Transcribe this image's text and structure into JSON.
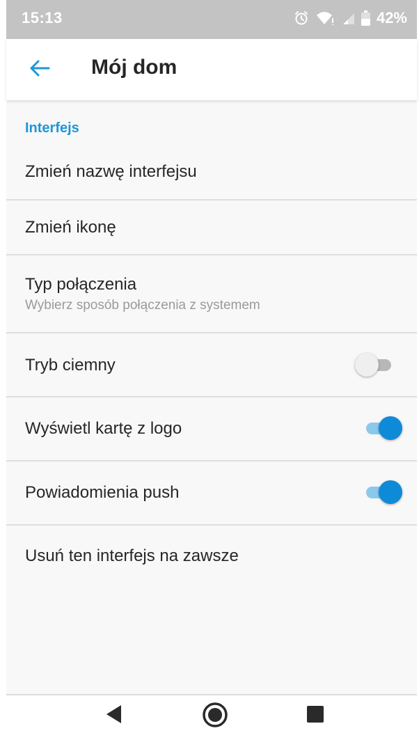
{
  "status_bar": {
    "time": "15:13",
    "battery_percent": "42%",
    "icons": [
      "alarm-icon",
      "wifi-icon",
      "signal-icon",
      "battery-icon"
    ]
  },
  "app_bar": {
    "back_icon": "arrow-left-icon",
    "title": "Mój dom"
  },
  "section": {
    "header": "Interfejs",
    "items": [
      {
        "title": "Zmień nazwę interfejsu"
      },
      {
        "title": "Zmień ikonę"
      },
      {
        "title": "Typ połączenia",
        "subtitle": "Wybierz sposób połączenia z systemem"
      },
      {
        "title": "Tryb ciemny",
        "toggle": false
      },
      {
        "title": "Wyświetl kartę z logo",
        "toggle": true
      },
      {
        "title": "Powiadomienia push",
        "toggle": true
      },
      {
        "title": "Usuń ten interfejs na zawsze"
      }
    ]
  },
  "nav_bar": {
    "buttons": [
      "back-triangle-icon",
      "home-circle-icon",
      "recents-square-icon"
    ]
  },
  "colors": {
    "accent": "#1e96d8",
    "toggle_on": "#0f8ad8",
    "status_bar": "#c3c3c3"
  }
}
